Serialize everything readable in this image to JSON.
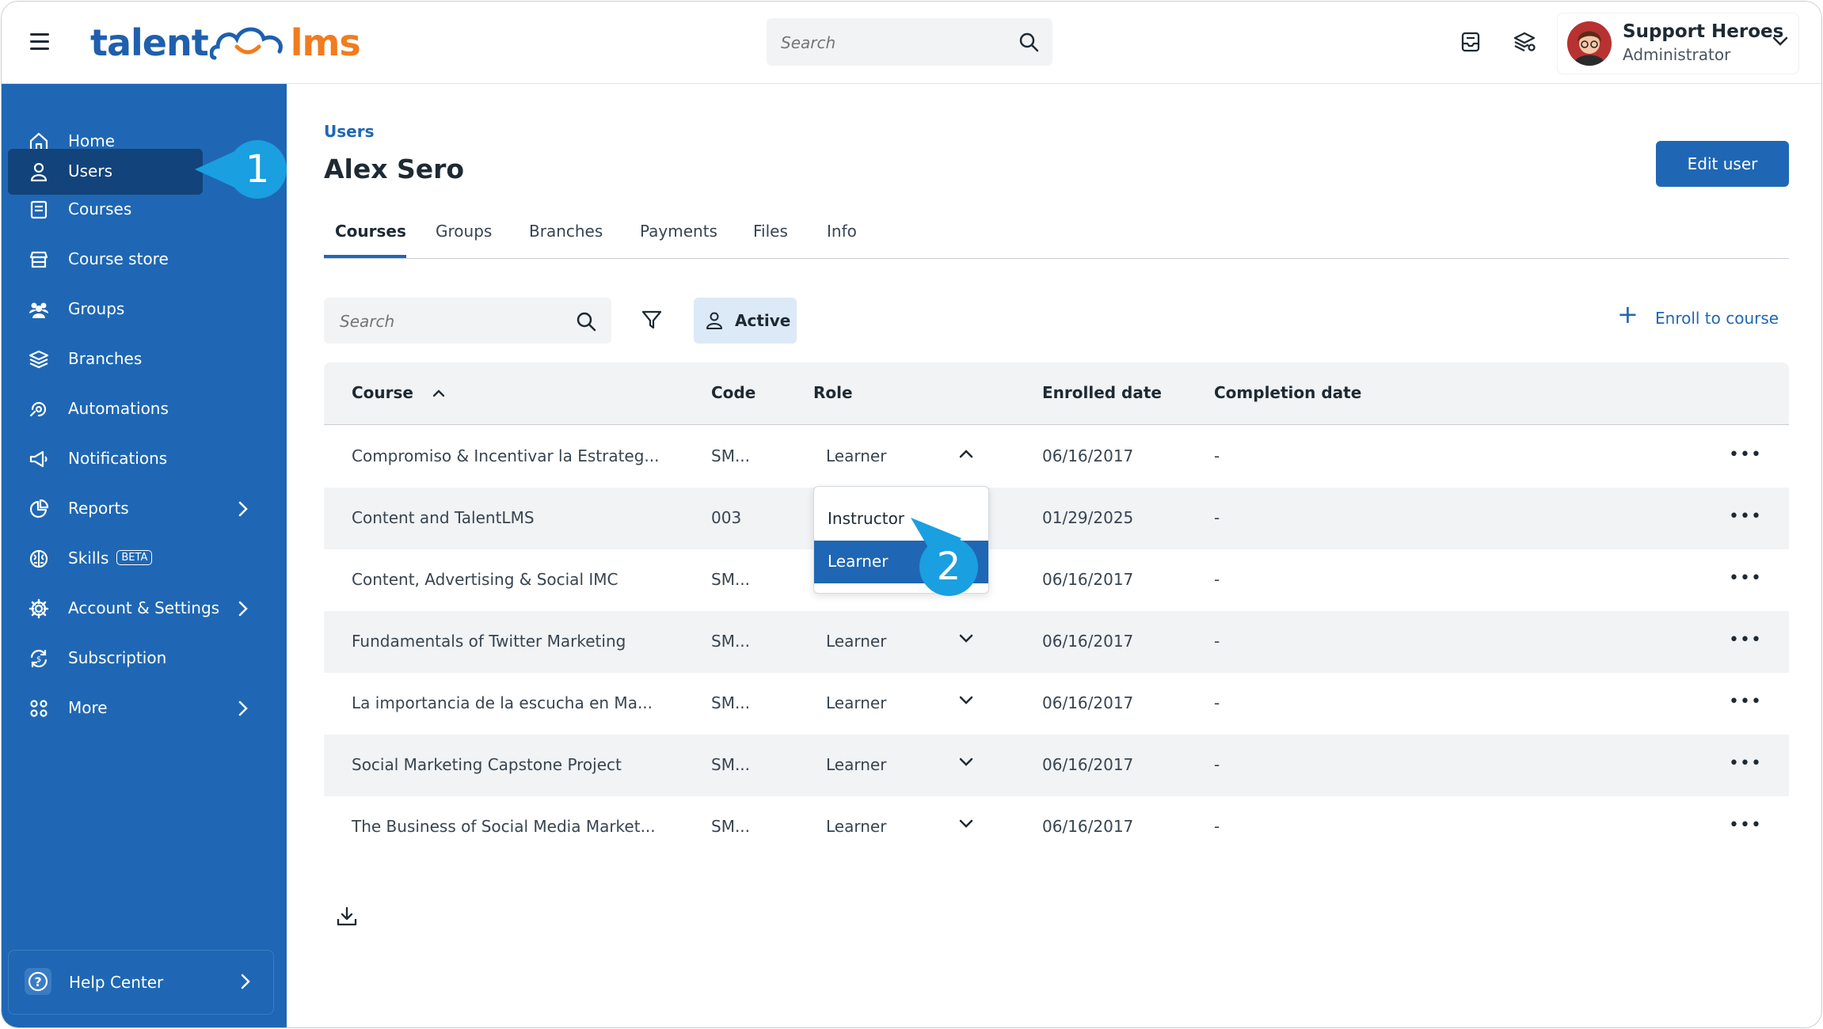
{
  "brand": {
    "part1": "talent",
    "part2": "lms",
    "colors": {
      "blue": "#1f5fae",
      "orange": "#f07c1f"
    }
  },
  "top_search": {
    "placeholder": "Search"
  },
  "profile": {
    "name": "Support Heroes",
    "role": "Administrator"
  },
  "sidebar": {
    "items": [
      {
        "label": "Home",
        "icon": "home-icon"
      },
      {
        "label": "Users",
        "icon": "user-icon"
      },
      {
        "label": "Courses",
        "icon": "book-icon"
      },
      {
        "label": "Course store",
        "icon": "store-icon"
      },
      {
        "label": "Groups",
        "icon": "groups-icon"
      },
      {
        "label": "Branches",
        "icon": "branches-icon"
      },
      {
        "label": "Automations",
        "icon": "automation-icon"
      },
      {
        "label": "Notifications",
        "icon": "megaphone-icon"
      },
      {
        "label": "Reports",
        "icon": "pie-chart-icon"
      },
      {
        "label": "Skills",
        "icon": "brain-icon",
        "badge": "BETA"
      },
      {
        "label": "Account & Settings",
        "icon": "gear-icon"
      },
      {
        "label": "Subscription",
        "icon": "subscription-icon"
      },
      {
        "label": "More",
        "icon": "grid-icon"
      }
    ],
    "help": "Help Center",
    "accent": "#1f67b4"
  },
  "callouts": {
    "one": "1",
    "two": "2"
  },
  "main": {
    "breadcrumb": "Users",
    "title": "Alex Sero",
    "edit_button": "Edit user",
    "tabs": [
      "Courses",
      "Groups",
      "Branches",
      "Payments",
      "Files",
      "Info"
    ],
    "search_placeholder": "Search",
    "active_filter": "Active",
    "enroll": "Enroll to course"
  },
  "table": {
    "headers": [
      "Course",
      "Code",
      "Role",
      "Enrolled date",
      "Completion date"
    ],
    "rows": [
      {
        "course": "Compromiso & Incentivar la Estrateg...",
        "code": "SM...",
        "role": "Learner",
        "enrolled": "06/16/2017",
        "completion": "-"
      },
      {
        "course": "Content and TalentLMS",
        "code": "003",
        "role": "",
        "enrolled": "01/29/2025",
        "completion": "-"
      },
      {
        "course": "Content, Advertising & Social IMC",
        "code": "SM...",
        "role": "",
        "enrolled": "06/16/2017",
        "completion": "-"
      },
      {
        "course": "Fundamentals of Twitter Marketing",
        "code": "SM...",
        "role": "Learner",
        "enrolled": "06/16/2017",
        "completion": "-"
      },
      {
        "course": "La importancia de la escucha en Ma...",
        "code": "SM...",
        "role": "Learner",
        "enrolled": "06/16/2017",
        "completion": "-"
      },
      {
        "course": "Social Marketing Capstone Project",
        "code": "SM...",
        "role": "Learner",
        "enrolled": "06/16/2017",
        "completion": "-"
      },
      {
        "course": "The Business of Social Media Market...",
        "code": "SM...",
        "role": "Learner",
        "enrolled": "06/16/2017",
        "completion": "-"
      }
    ],
    "role_options": [
      "Instructor",
      "Learner"
    ],
    "selected_role": "Learner"
  }
}
